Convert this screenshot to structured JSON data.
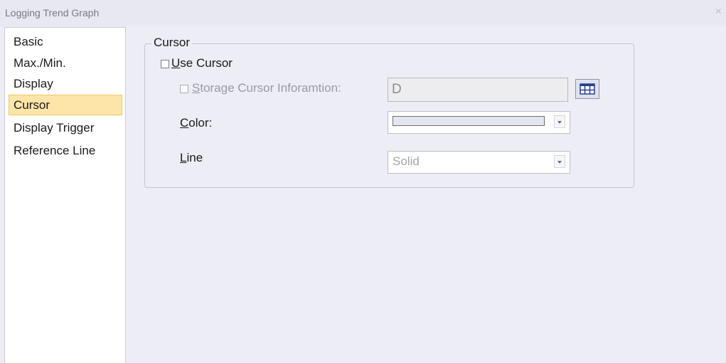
{
  "window": {
    "title": "Logging Trend Graph",
    "close_label": "×"
  },
  "sidebar": {
    "items": [
      {
        "label": "Basic"
      },
      {
        "label": "Max./Min."
      },
      {
        "label": "Display"
      },
      {
        "label": "Cursor",
        "selected": true
      },
      {
        "label": "Display Trigger"
      },
      {
        "label": "Reference Line"
      }
    ]
  },
  "cursor_group": {
    "title": "Cursor",
    "use_cursor": {
      "underline": "U",
      "rest": "se Cursor",
      "checked": false
    },
    "storage": {
      "underline": "S",
      "rest": "torage Cursor Inforamtion:",
      "checked": false,
      "enabled": false,
      "value": "D"
    },
    "color": {
      "underline": "C",
      "rest": "olor:",
      "swatch": "#e3e6ee"
    },
    "line": {
      "underline": "L",
      "rest": "ine",
      "value": "Solid"
    }
  },
  "colors": {
    "selected_bg": "#fde4a8",
    "window_bg": "#ecedf5"
  }
}
